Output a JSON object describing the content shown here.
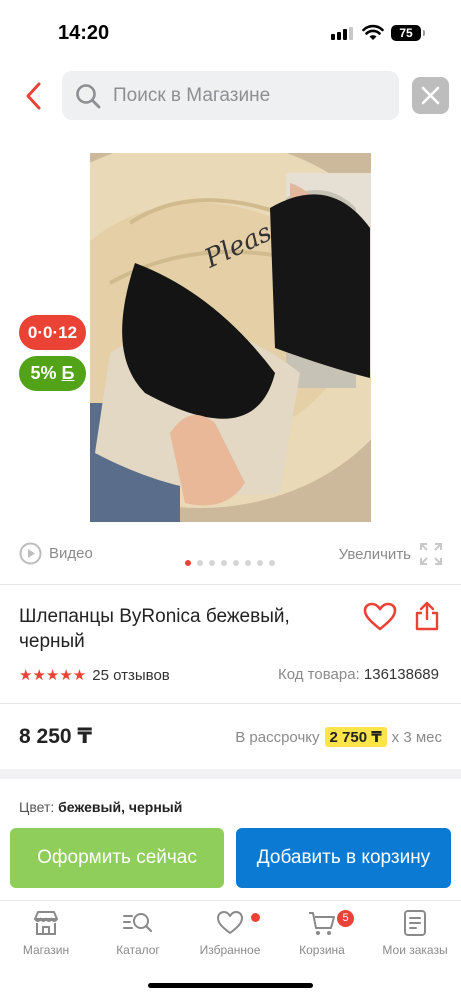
{
  "status_bar": {
    "time": "14:20",
    "battery": "75"
  },
  "search": {
    "placeholder": "Поиск в Магазине"
  },
  "badges": {
    "timer": "0·0·12",
    "discount": "5%",
    "currency_glyph": "Б"
  },
  "media": {
    "video_label": "Видео",
    "zoom_label": "Увеличить",
    "slide_count": 8,
    "active_slide": 1
  },
  "product": {
    "title": "Шлепанцы ByRonica бежевый, черный",
    "stars": "★★★★★",
    "reviews": "25 отзывов",
    "code_label": "Код товара:",
    "code_value": "136138689",
    "price": "8 250 ₸",
    "installment_prefix": "В рассрочку",
    "installment_amount": "2 750 ₸",
    "installment_suffix": "х 3 мес",
    "color_label": "Цвет:",
    "color_value": "бежевый, черный"
  },
  "actions": {
    "buy_now": "Оформить сейчас",
    "add_to_cart": "Добавить в корзину"
  },
  "tabbar": {
    "items": [
      {
        "label": "Магазин",
        "icon": "shop-icon"
      },
      {
        "label": "Каталог",
        "icon": "catalog-search-icon"
      },
      {
        "label": "Избранное",
        "icon": "heart-icon"
      },
      {
        "label": "Корзина",
        "icon": "cart-icon"
      },
      {
        "label": "Мои заказы",
        "icon": "orders-icon"
      }
    ],
    "cart_count": "5"
  },
  "colors": {
    "accent_red": "#ea4335",
    "green": "#53a318",
    "buy_button": "#8fce5a",
    "cart_button": "#0a7ad2",
    "installment_highlight": "#ffe34a"
  }
}
